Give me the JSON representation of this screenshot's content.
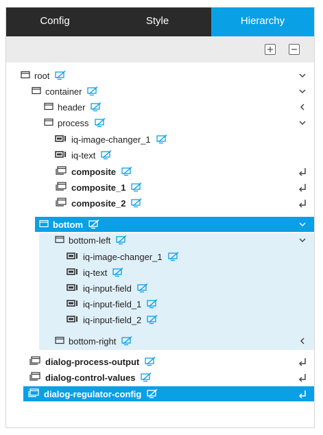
{
  "tabs": [
    {
      "label": "Config",
      "active": false
    },
    {
      "label": "Style",
      "active": false
    },
    {
      "label": "Hierarchy",
      "active": true
    }
  ],
  "toolbar": {
    "expand_all_icon": "expand-all-icon",
    "collapse_all_icon": "collapse-all-icon"
  },
  "colors": {
    "accent": "#0aa0e6",
    "tab_bar": "#2a2a2a",
    "selection_light": "#dff0f9",
    "toolbar": "#ebebeb"
  },
  "tree": [
    {
      "label": "root",
      "type": "container",
      "bold": false,
      "toggle": "chevron-down"
    },
    {
      "label": "container",
      "type": "container",
      "bold": false,
      "toggle": "chevron-down"
    },
    {
      "label": "header",
      "type": "container",
      "bold": false,
      "toggle": "chevron-left"
    },
    {
      "label": "process",
      "type": "container",
      "bold": false,
      "toggle": "chevron-down"
    },
    {
      "label": "iq-image-changer_1",
      "type": "widget",
      "bold": false,
      "toggle": ""
    },
    {
      "label": "iq-text",
      "type": "widget",
      "bold": false,
      "toggle": ""
    },
    {
      "label": "composite",
      "type": "composite",
      "bold": true,
      "toggle": "enter"
    },
    {
      "label": "composite_1",
      "type": "composite",
      "bold": true,
      "toggle": "enter"
    },
    {
      "label": "composite_2",
      "type": "composite",
      "bold": true,
      "toggle": "enter"
    },
    {
      "label": "bottom",
      "type": "container",
      "bold": true,
      "toggle": "chevron-down",
      "selected": true
    },
    {
      "label": "bottom-left",
      "type": "container",
      "bold": false,
      "toggle": "chevron-down"
    },
    {
      "label": "iq-image-changer_1",
      "type": "widget",
      "bold": false,
      "toggle": ""
    },
    {
      "label": "iq-text",
      "type": "widget",
      "bold": false,
      "toggle": ""
    },
    {
      "label": "iq-input-field",
      "type": "widget",
      "bold": false,
      "toggle": ""
    },
    {
      "label": "iq-input-field_1",
      "type": "widget",
      "bold": false,
      "toggle": ""
    },
    {
      "label": "iq-input-field_2",
      "type": "widget",
      "bold": false,
      "toggle": ""
    },
    {
      "label": "bottom-right",
      "type": "container",
      "bold": false,
      "toggle": "chevron-left"
    },
    {
      "label": "dialog-process-output",
      "type": "composite",
      "bold": true,
      "toggle": "enter"
    },
    {
      "label": "dialog-control-values",
      "type": "composite",
      "bold": true,
      "toggle": "enter"
    },
    {
      "label": "dialog-regulator-config",
      "type": "composite",
      "bold": true,
      "toggle": "enter",
      "selected": true
    }
  ]
}
